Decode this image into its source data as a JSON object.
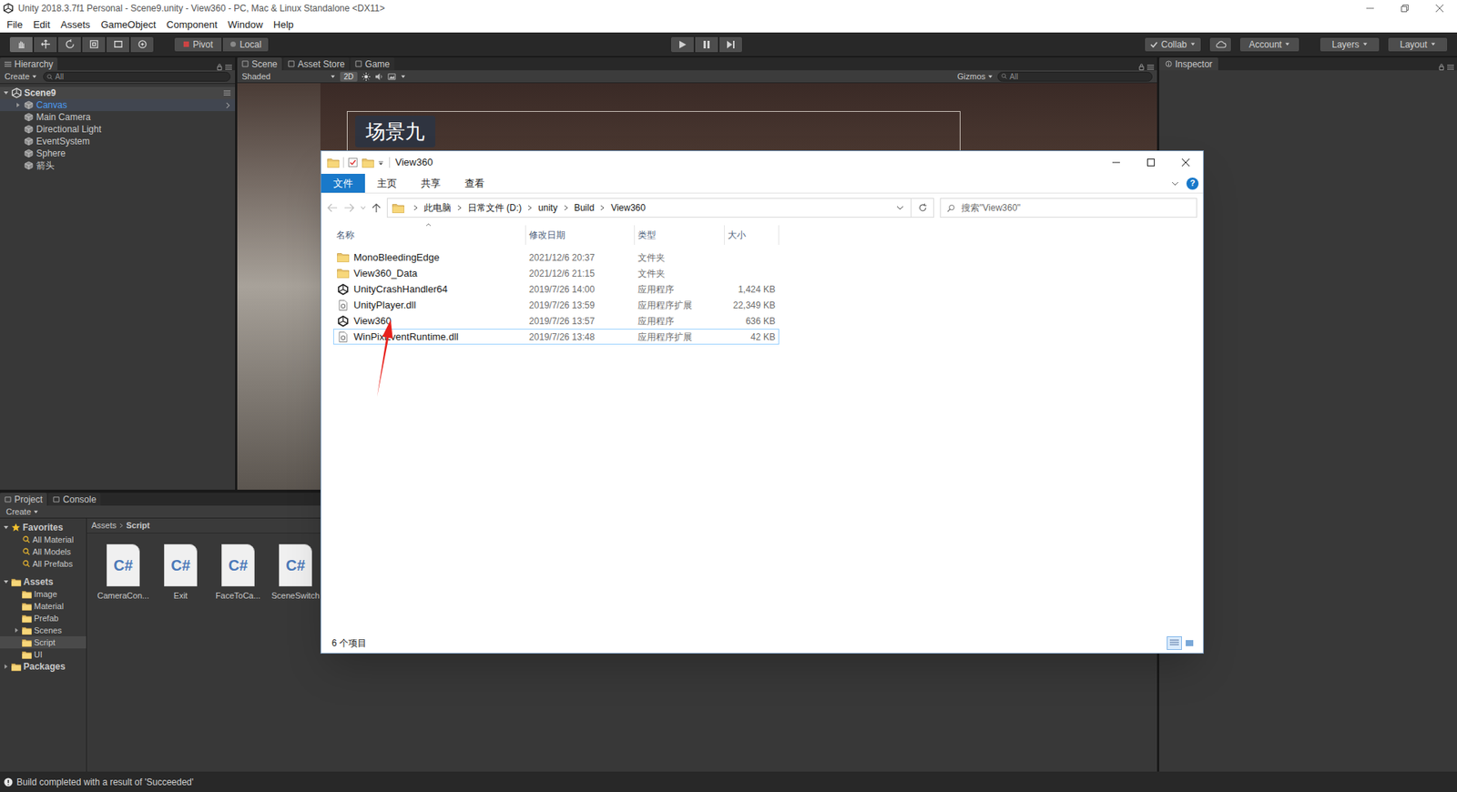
{
  "unity": {
    "title": "Unity 2018.3.7f1 Personal - Scene9.unity - View360 - PC, Mac & Linux Standalone <DX11>",
    "menu": [
      "File",
      "Edit",
      "Assets",
      "GameObject",
      "Component",
      "Window",
      "Help"
    ],
    "toolbar": {
      "pivot": "Pivot",
      "local": "Local",
      "collab": "Collab",
      "account": "Account",
      "layers": "Layers",
      "layout": "Layout"
    },
    "hierarchy": {
      "tab": "Hierarchy",
      "create": "Create",
      "search": "All",
      "scene": "Scene9",
      "items": [
        {
          "label": "Canvas",
          "highlighted": true,
          "expandable": true
        },
        {
          "label": "Main Camera",
          "highlighted": false,
          "expandable": false
        },
        {
          "label": "Directional Light",
          "highlighted": false,
          "expandable": false
        },
        {
          "label": "EventSystem",
          "highlighted": false,
          "expandable": false
        },
        {
          "label": "Sphere",
          "highlighted": false,
          "expandable": false
        },
        {
          "label": "箭头",
          "highlighted": false,
          "expandable": false
        }
      ]
    },
    "scene": {
      "tabs": [
        {
          "label": "Scene",
          "selected": true
        },
        {
          "label": "Asset Store",
          "selected": false
        },
        {
          "label": "Game",
          "selected": false
        }
      ],
      "shading": "Shaded",
      "mode_2d": {
        "label": "2D",
        "on": true
      },
      "gizmos": "Gizmos",
      "search": "All",
      "label": "场景九"
    },
    "inspector": {
      "tab": "Inspector"
    },
    "project": {
      "tabs": [
        {
          "label": "Project",
          "selected": true
        },
        {
          "label": "Console",
          "selected": false
        }
      ],
      "create": "Create",
      "favorites": {
        "label": "Favorites",
        "items": [
          "All Material",
          "All Models",
          "All Prefabs"
        ]
      },
      "assets": {
        "label": "Assets",
        "folders": [
          {
            "label": "Image",
            "selected": false,
            "expandable": false
          },
          {
            "label": "Material",
            "selected": false,
            "expandable": false
          },
          {
            "label": "Prefab",
            "selected": false,
            "expandable": false
          },
          {
            "label": "Scenes",
            "selected": false,
            "expandable": true
          },
          {
            "label": "Script",
            "selected": true,
            "expandable": false
          },
          {
            "label": "UI",
            "selected": false,
            "expandable": false
          }
        ]
      },
      "packages": "Packages",
      "breadcrumb": [
        "Assets",
        "Script"
      ],
      "files": [
        {
          "name": "CameraCon...",
          "icon_text": "C#"
        },
        {
          "name": "Exit",
          "icon_text": "C#"
        },
        {
          "name": "FaceToCa...",
          "icon_text": "C#"
        },
        {
          "name": "SceneSwitch",
          "icon_text": "C#"
        }
      ]
    },
    "status": "Build completed with a result of 'Succeeded'"
  },
  "explorer": {
    "title": "View360",
    "ribbon": [
      {
        "label": "文件",
        "selected": true
      },
      {
        "label": "主页",
        "selected": false
      },
      {
        "label": "共享",
        "selected": false
      },
      {
        "label": "查看",
        "selected": false
      }
    ],
    "help": "?",
    "breadcrumb": [
      "此电脑",
      "日常文件 (D:)",
      "unity",
      "Build",
      "View360"
    ],
    "search": {
      "placeholder": "搜索\"View360\""
    },
    "columns": [
      "名称",
      "修改日期",
      "类型",
      "大小"
    ],
    "rows": [
      {
        "name": "MonoBleedingEdge",
        "date": "2021/12/6 20:37",
        "type": "文件夹",
        "size": "",
        "kind": "folder",
        "focused": false
      },
      {
        "name": "View360_Data",
        "date": "2021/12/6 21:15",
        "type": "文件夹",
        "size": "",
        "kind": "folder",
        "focused": false
      },
      {
        "name": "UnityCrashHandler64",
        "date": "2019/7/26 14:00",
        "type": "应用程序",
        "size": "1,424 KB",
        "kind": "exe",
        "focused": false
      },
      {
        "name": "UnityPlayer.dll",
        "date": "2019/7/26 13:59",
        "type": "应用程序扩展",
        "size": "22,349 KB",
        "kind": "dll",
        "focused": false
      },
      {
        "name": "View360",
        "date": "2019/7/26 13:57",
        "type": "应用程序",
        "size": "636 KB",
        "kind": "exe",
        "focused": false
      },
      {
        "name": "WinPixEventRuntime.dll",
        "date": "2019/7/26 13:48",
        "type": "应用程序扩展",
        "size": "42 KB",
        "kind": "dll",
        "focused": true
      }
    ],
    "status": "6 个项目",
    "view": {
      "details_selected": true
    }
  }
}
